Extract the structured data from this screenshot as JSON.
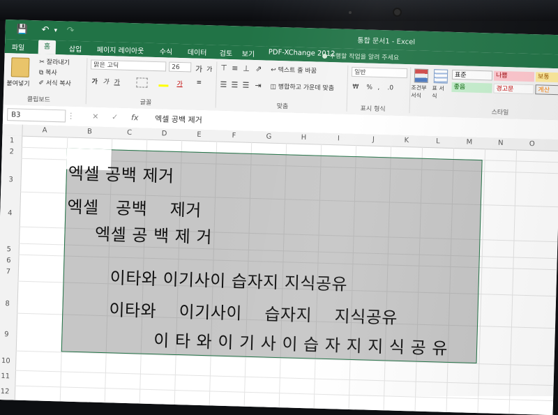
{
  "window": {
    "title": "통합 문서1 - Excel"
  },
  "quick_access": {
    "save_icon": "save-icon",
    "undo_icon": "undo-icon",
    "redo_icon": "redo-icon"
  },
  "tabs": [
    {
      "label": "파일"
    },
    {
      "label": "홈",
      "active": true
    },
    {
      "label": "삽입"
    },
    {
      "label": "페이지 레이아웃"
    },
    {
      "label": "수식"
    },
    {
      "label": "데이터"
    },
    {
      "label": "검토"
    },
    {
      "label": "보기"
    },
    {
      "label": "PDF-XChange 2012"
    }
  ],
  "tell_me": "수행할 작업을 알려 주세요",
  "ribbon": {
    "clipboard": {
      "paste": "붙여넣기",
      "cut": "잘라내기",
      "copy": "복사",
      "format_painter": "서식 복사",
      "label": "클립보드"
    },
    "font": {
      "name": "맑은 고딕",
      "size": "26",
      "grow": "가",
      "shrink": "가",
      "bold": "가",
      "italic": "가",
      "underline": "가",
      "color_letter": "가",
      "label": "글꼴"
    },
    "alignment": {
      "wrap": "텍스트 줄 바꿈",
      "merge": "병합하고 가운데 맞춤",
      "label": "맞춤"
    },
    "number": {
      "format": "일반",
      "label": "표시 형식"
    },
    "styles": {
      "conditional": "조건부 서식",
      "table": "표 서식",
      "cells": [
        {
          "label": "표준",
          "color": "#ffffff"
        },
        {
          "label": "나쁨",
          "color": "#ffc7ce"
        },
        {
          "label": "보통",
          "color": "#ffeb9c"
        },
        {
          "label": "좋음",
          "color": "#c6efce"
        },
        {
          "label": "경고문",
          "color": "#ffffff"
        },
        {
          "label": "계산",
          "color": "#f2f2f2"
        }
      ],
      "label": "스타일"
    }
  },
  "formula_bar": {
    "name_box": "B3",
    "cancel": "✕",
    "enter": "✓",
    "fx": "fx",
    "content": "엑셀 공백 제거"
  },
  "columns": [
    "A",
    "B",
    "C",
    "D",
    "E",
    "F",
    "G",
    "H",
    "I",
    "J",
    "K",
    "L",
    "M",
    "N",
    "O"
  ],
  "rows": [
    "1",
    "2",
    "3",
    "4",
    "5",
    "6",
    "7",
    "8",
    "9",
    "10",
    "11",
    "12"
  ],
  "cells": [
    "엑셀 공백 제거",
    "엑셀   공백    제거",
    "     엑셀 공 백 제 거",
    "이타와 이기사이 습자지 지식공유",
    "이타와    이기사이    습자지    지식공유",
    "        이 타 와 이 기 사 이 습 자 지 지 식 공 유"
  ],
  "colors": {
    "excel_green": "#217346",
    "selection": "#8a8a8a"
  }
}
